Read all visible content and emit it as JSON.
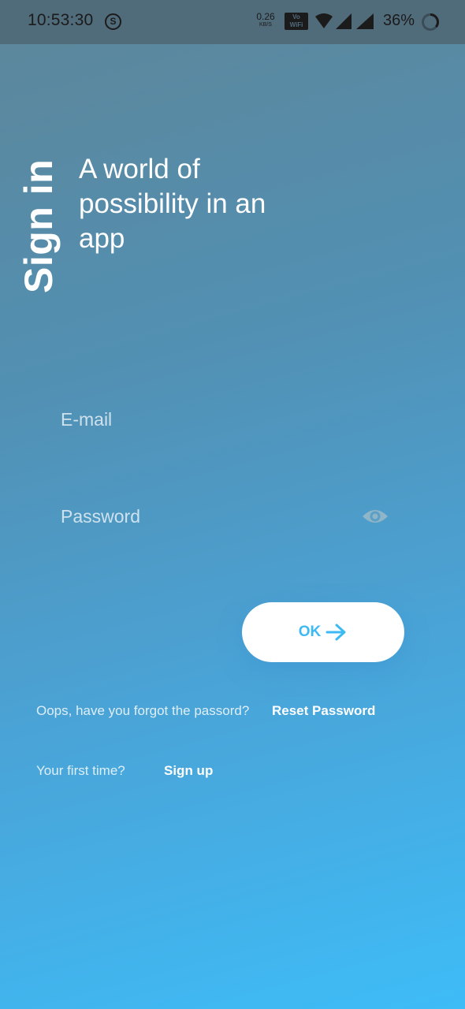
{
  "status_bar": {
    "time": "10:53:30",
    "sync_icon_letter": "S",
    "network_speed": "0.26",
    "network_speed_unit": "KB/S",
    "volte_top": "Vo",
    "volte_bottom": "WiFi",
    "battery_percent": "36%",
    "battery_level": 0.36,
    "icons": [
      "sync-icon",
      "wifi-icon",
      "signal-icon",
      "signal-icon",
      "battery-ring-icon"
    ]
  },
  "header": {
    "vertical_title": "Sign in",
    "tagline": "A world of possibility in an app"
  },
  "form": {
    "email_placeholder": "E-mail",
    "email_value": "",
    "password_placeholder": "Password",
    "password_value": "",
    "eye_icon": "eye-icon",
    "ok_label": "OK",
    "ok_icon": "arrow-right-icon"
  },
  "links": {
    "forgot_text": "Oops, have you forgot the passord?",
    "reset_label": "Reset Password",
    "first_time_text": "Your first time?",
    "signup_label": "Sign up"
  },
  "colors": {
    "accent": "#3dbaf3",
    "gradient_top": "#5d8699",
    "gradient_bottom": "#3ebcf7",
    "status_bar": "#506b7a"
  }
}
